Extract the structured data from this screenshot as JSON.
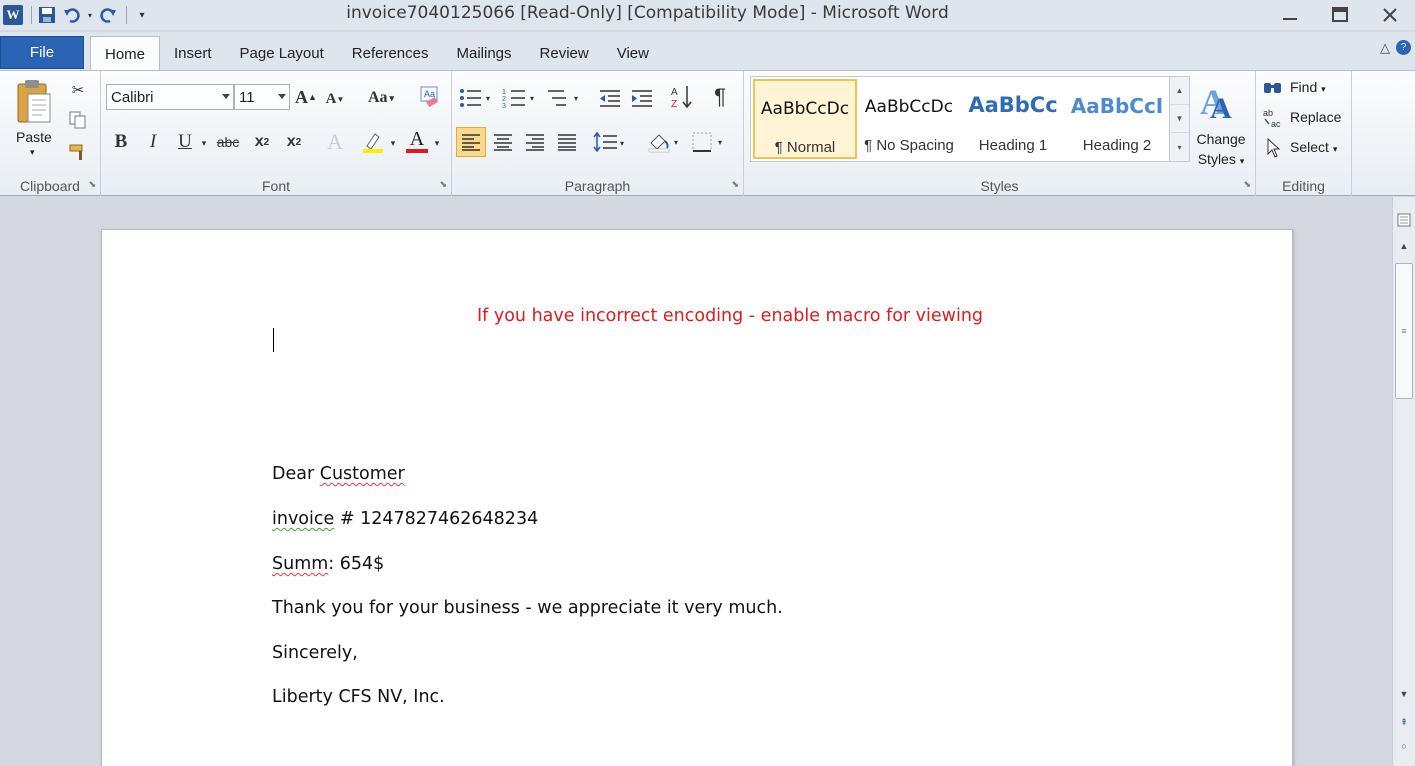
{
  "window": {
    "title": "invoice7040125066 [Read-Only] [Compatibility Mode]  -  Microsoft Word",
    "app_icon": "W"
  },
  "quick_access": [
    "save-icon",
    "undo-icon",
    "redo-icon",
    "customize-icon"
  ],
  "tabs": {
    "file": "File",
    "items": [
      "Home",
      "Insert",
      "Page Layout",
      "References",
      "Mailings",
      "Review",
      "View"
    ],
    "active": "Home"
  },
  "ribbon": {
    "clipboard": {
      "paste": "Paste",
      "label": "Clipboard"
    },
    "font": {
      "family": "Calibri",
      "size": "11",
      "grow": "A",
      "shrink": "A",
      "change_case": "Aa",
      "bold": "B",
      "italic": "I",
      "underline": "U",
      "strikethrough": "abc",
      "subscript": "x",
      "subscript_mark": "2",
      "superscript": "x",
      "superscript_mark": "2",
      "color_letter": "A",
      "label": "Font"
    },
    "paragraph": {
      "label": "Paragraph",
      "pilcrow": "¶"
    },
    "styles": {
      "label": "Styles",
      "tiles": [
        {
          "sample": "AaBbCcDc",
          "name": "¶ Normal"
        },
        {
          "sample": "AaBbCcDc",
          "name": "¶ No Spacing"
        },
        {
          "sample": "AaBbCc",
          "name": "Heading 1"
        },
        {
          "sample": "AaBbCcI",
          "name": "Heading 2"
        }
      ],
      "change_styles_line1": "Change",
      "change_styles_line2": "Styles"
    },
    "editing": {
      "find": "Find",
      "replace": "Replace",
      "select": "Select",
      "label": "Editing"
    }
  },
  "document": {
    "warning": "If you have incorrect encoding - enable macro for viewing",
    "greeting_word": "Dear ",
    "greeting_name": "Customer",
    "invoice_word": "invoice",
    "invoice_rest": " # 1247827462648234",
    "summ_word": "Summ",
    "summ_rest": ": 654$",
    "thanks": "Thank you for your business - we appreciate it very much.",
    "closing": "Sincerely,",
    "company": "Liberty CFS NV, Inc."
  },
  "colors": {
    "file_tab": "#2b63b5",
    "warning_text": "#e01b1b",
    "selected_style": "#f2c24e",
    "heading_blue": "#2e6db4"
  }
}
